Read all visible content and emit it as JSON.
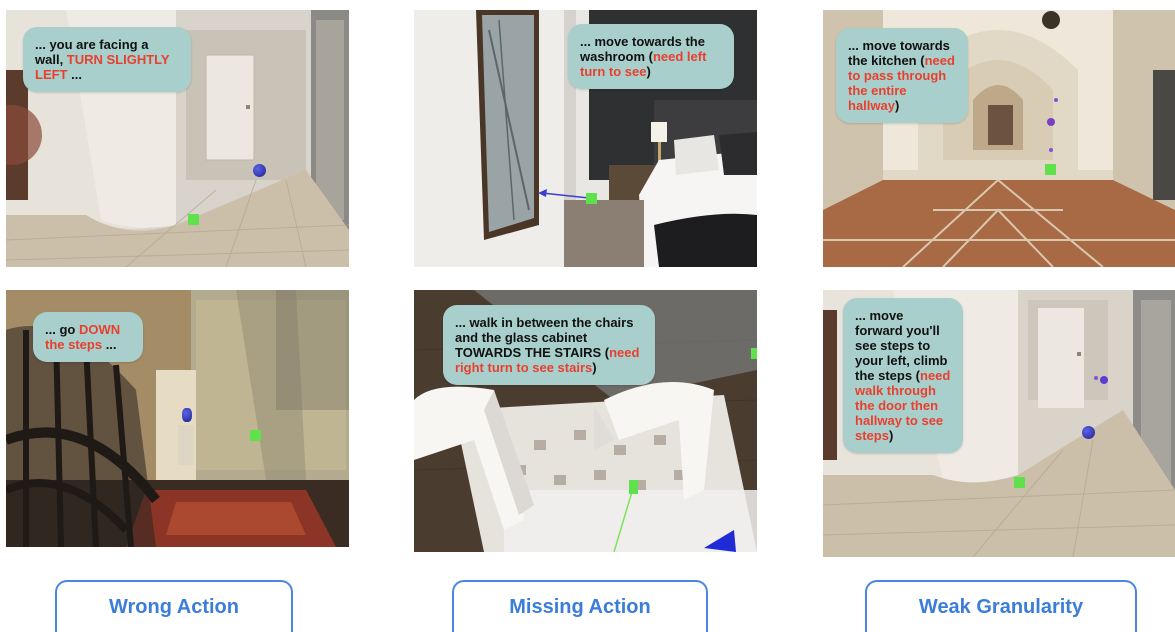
{
  "panels": [
    {
      "bubble": {
        "text": "... you are facing a wall, ",
        "highlight": "TURN SLIGHTLY LEFT",
        "suffix": " ..."
      }
    },
    {
      "bubble": {
        "text": "... go ",
        "highlight": "DOWN the steps",
        "suffix": " ..."
      }
    },
    {
      "bubble": {
        "text": "... move towards the washroom (",
        "highlight": "need left turn to see",
        "suffix": ")"
      }
    },
    {
      "bubble": {
        "text": "... walk in between the chairs and the glass cabinet TOWARDS THE STAIRS (",
        "highlight": "need right turn to see stairs",
        "suffix": ")"
      }
    },
    {
      "bubble": {
        "text": "... move towards the kitchen (",
        "highlight": "need to pass through the entire hallway",
        "suffix": ")"
      }
    },
    {
      "bubble": {
        "text": "... move forward you'll see steps to your left, climb the steps (",
        "highlight": "need walk through the door then hallway to see steps",
        "suffix": ")"
      }
    }
  ],
  "labels": {
    "col1": "Wrong Action",
    "col2": "Missing Action",
    "col3": "Weak Granularity"
  },
  "colors": {
    "bubble_bg": "#a9cfcc",
    "highlight": "#e8402f",
    "label_text": "#3b7dd8",
    "label_border": "#4a87e0",
    "marker": "#5ee14a",
    "agent": "#2a2fb5"
  }
}
